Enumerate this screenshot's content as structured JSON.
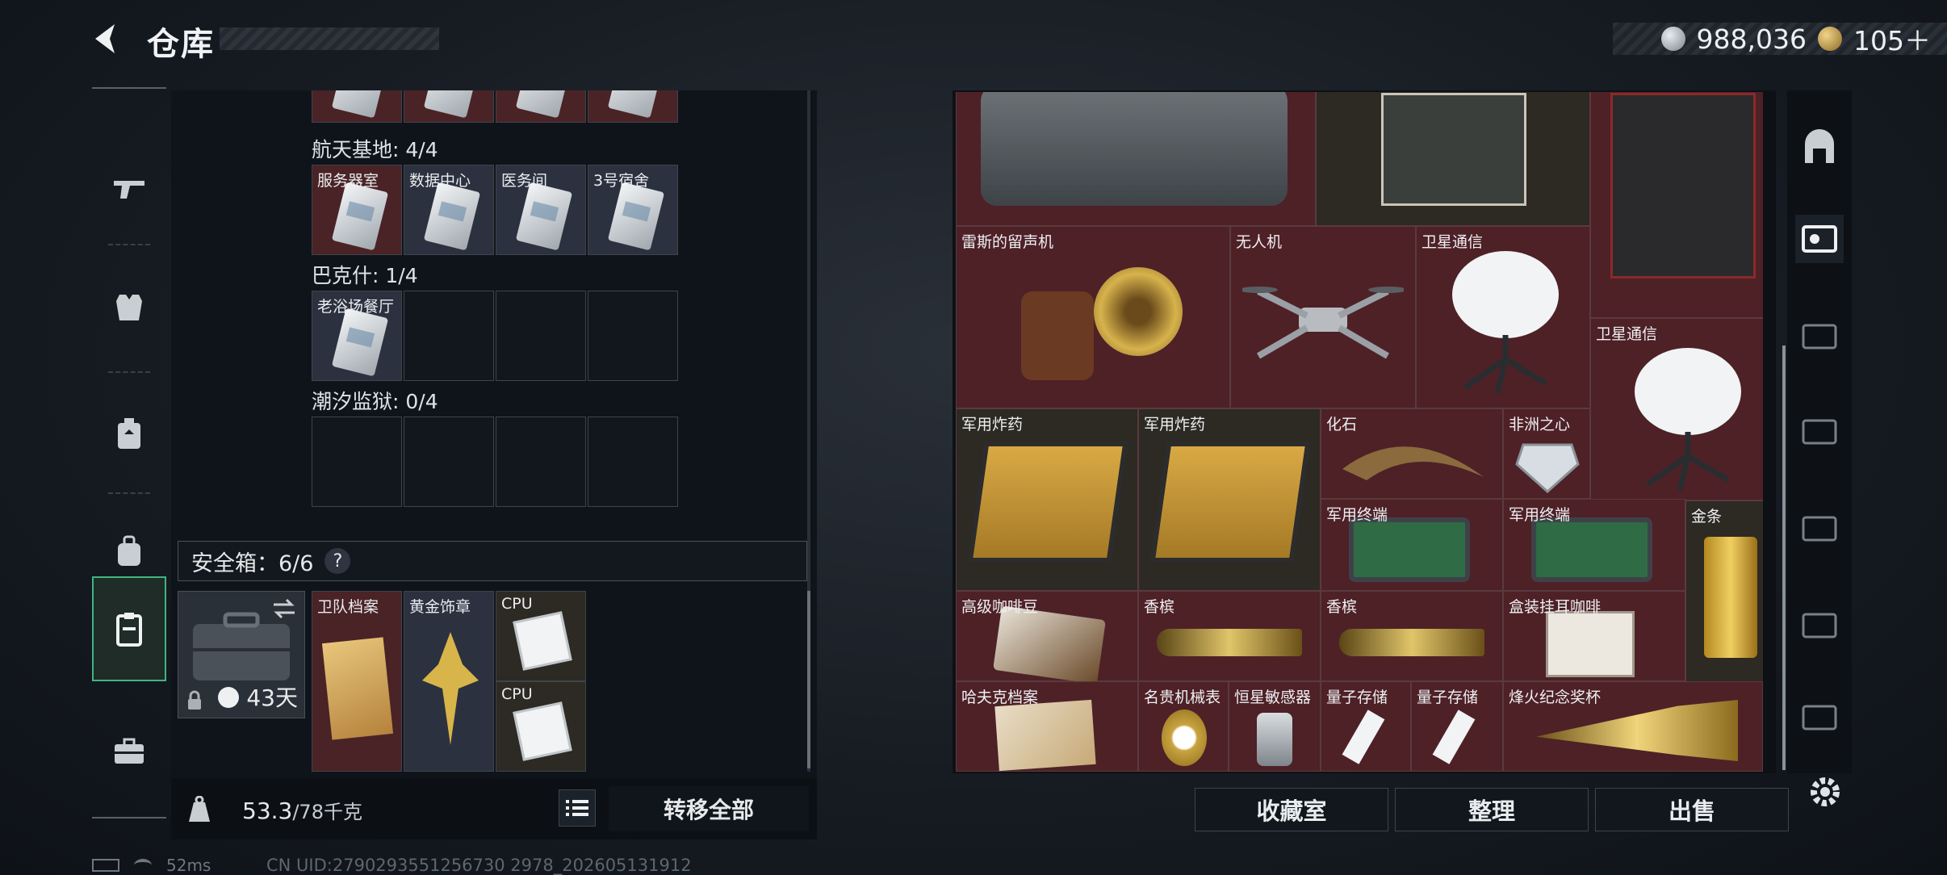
{
  "header": {
    "title": "仓库"
  },
  "currency": {
    "silver": "988,036",
    "gold": "105＋"
  },
  "storage": {
    "category_1": {
      "name": "航天基地: 4/4",
      "cards": [
        "服务器室",
        "数据中心",
        "医务间",
        "3号宿舍"
      ]
    },
    "category_2": {
      "name": "巴克什: 1/4",
      "cards": [
        "老浴场餐厅"
      ]
    },
    "category_3": {
      "name": "潮汐监狱: 0/4"
    }
  },
  "safebox": {
    "label": "安全箱：6/6",
    "help": "?",
    "days": "43天",
    "items": [
      "卫队档案",
      "黄金饰章",
      "CPU",
      "CPU"
    ]
  },
  "footer": {
    "weight_current": "53.3",
    "weight_capacity": "/78千克",
    "transfer_all": "转移全部"
  },
  "grid_items": [
    "雷斯的留声机",
    "无人机",
    "卫星通信",
    "卫星通信",
    "军用炸药",
    "军用炸药",
    "化石",
    "非洲之心",
    "军用终端",
    "军用终端",
    "金条",
    "高级咖啡豆",
    "香槟",
    "香槟",
    "盒装挂耳咖啡",
    "哈夫克档案",
    "名贵机械表",
    "恒星敏感器",
    "量子存储",
    "量子存储",
    "烽火纪念奖杯"
  ],
  "actions": {
    "collection": "收藏室",
    "arrange": "整理",
    "sell": "出售"
  },
  "status": {
    "ping": "52ms",
    "uid": "CN UID:2790293551256730 2978_202605131912"
  },
  "colors": {
    "accent_green": "#3fb57f",
    "cell_maroon": "#4e2127",
    "cell_dark": "#2d2a23"
  }
}
